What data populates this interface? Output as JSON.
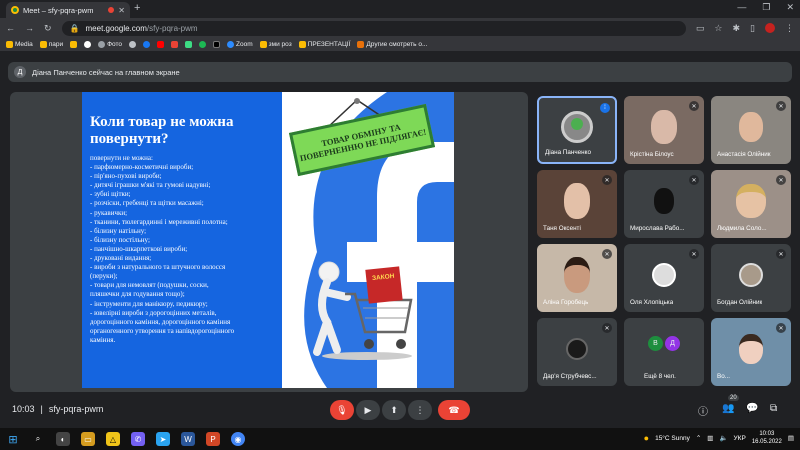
{
  "browser": {
    "tab_title": "Meet – sfy-pqra-pwm",
    "url_host": "meet.google.com",
    "url_path": "/sfy-pqra-pwm",
    "bookmarks": [
      "Media",
      "пари",
      "",
      "Фото",
      "",
      "",
      "",
      "",
      "",
      "",
      "Zoom",
      "зми роз",
      "ПРЕЗЕНТАЦІЇ",
      "Другие смотреть о..."
    ]
  },
  "banner": {
    "avatar_letter": "Д",
    "text": "Діана Панченко сейчас на главном экране"
  },
  "slide": {
    "title": "Коли товар не можна повернути?",
    "sign_line1": "ТОВАР ОБМІНУ ТА",
    "sign_line2": "ПОВЕРНЕННЮ НЕ ПІДЛЯГАЄ!",
    "cart_label": "ЗАКОН",
    "list": [
      "повернути не можна:",
      "- парфюмерно-косметичні вироби;",
      "- пір'яно-пухові вироби;",
      "- дитячі іграшки м'які та гумові надувні;",
      "- зубні щітки;",
      "- розчіски, гребенці та щітки масажні;",
      "- рукавички;",
      "- тканини, тюлегардинні і мереживні полотна;",
      "- білизну натільну;",
      "- білизну постільну;",
      "- панчішно-шкарпеткові вироби;",
      "- друковані видання;",
      "- вироби з натурального та штучного волосся",
      "(перуки);",
      "- товари для немовлят (подушки, соски,",
      "пляшечки для годування тощо);",
      "- інструменти для манікюру, педикюру;",
      "- ювелірні вироби з дорогоцінних металів,",
      "дорогоцінного каміння, дорогоцінного каміння",
      "органогенного утворення та напівдорогоцінного",
      "каміння."
    ]
  },
  "participants": [
    {
      "name": "Діана Панченко",
      "active": true
    },
    {
      "name": "Крістіна Білоус"
    },
    {
      "name": "Анастасія Олійник"
    },
    {
      "name": "Таня Оксенті"
    },
    {
      "name": "Мирослава Рабо..."
    },
    {
      "name": "Людмила Соло..."
    },
    {
      "name": "Аліна Горобець"
    },
    {
      "name": "Оля Хлопіцька"
    },
    {
      "name": "Богдан Олійник"
    },
    {
      "name": "Дар'я Струбчевс..."
    },
    {
      "name": "Ещё 8 чел.",
      "letters": [
        "В",
        "Д"
      ]
    },
    {
      "name": "Во..."
    }
  ],
  "meeting": {
    "time": "10:03",
    "code": "sfy-pqra-pwm",
    "people_count": "20"
  },
  "taskbar": {
    "weather": "15°C Sunny",
    "lang": "УКР",
    "time": "10:03",
    "date": "16.05.2022"
  },
  "colors": {
    "accent": "#8ab4f8",
    "end_call": "#ea4335",
    "slide_blue": "#1565e0",
    "sign_green": "#7ed957"
  }
}
